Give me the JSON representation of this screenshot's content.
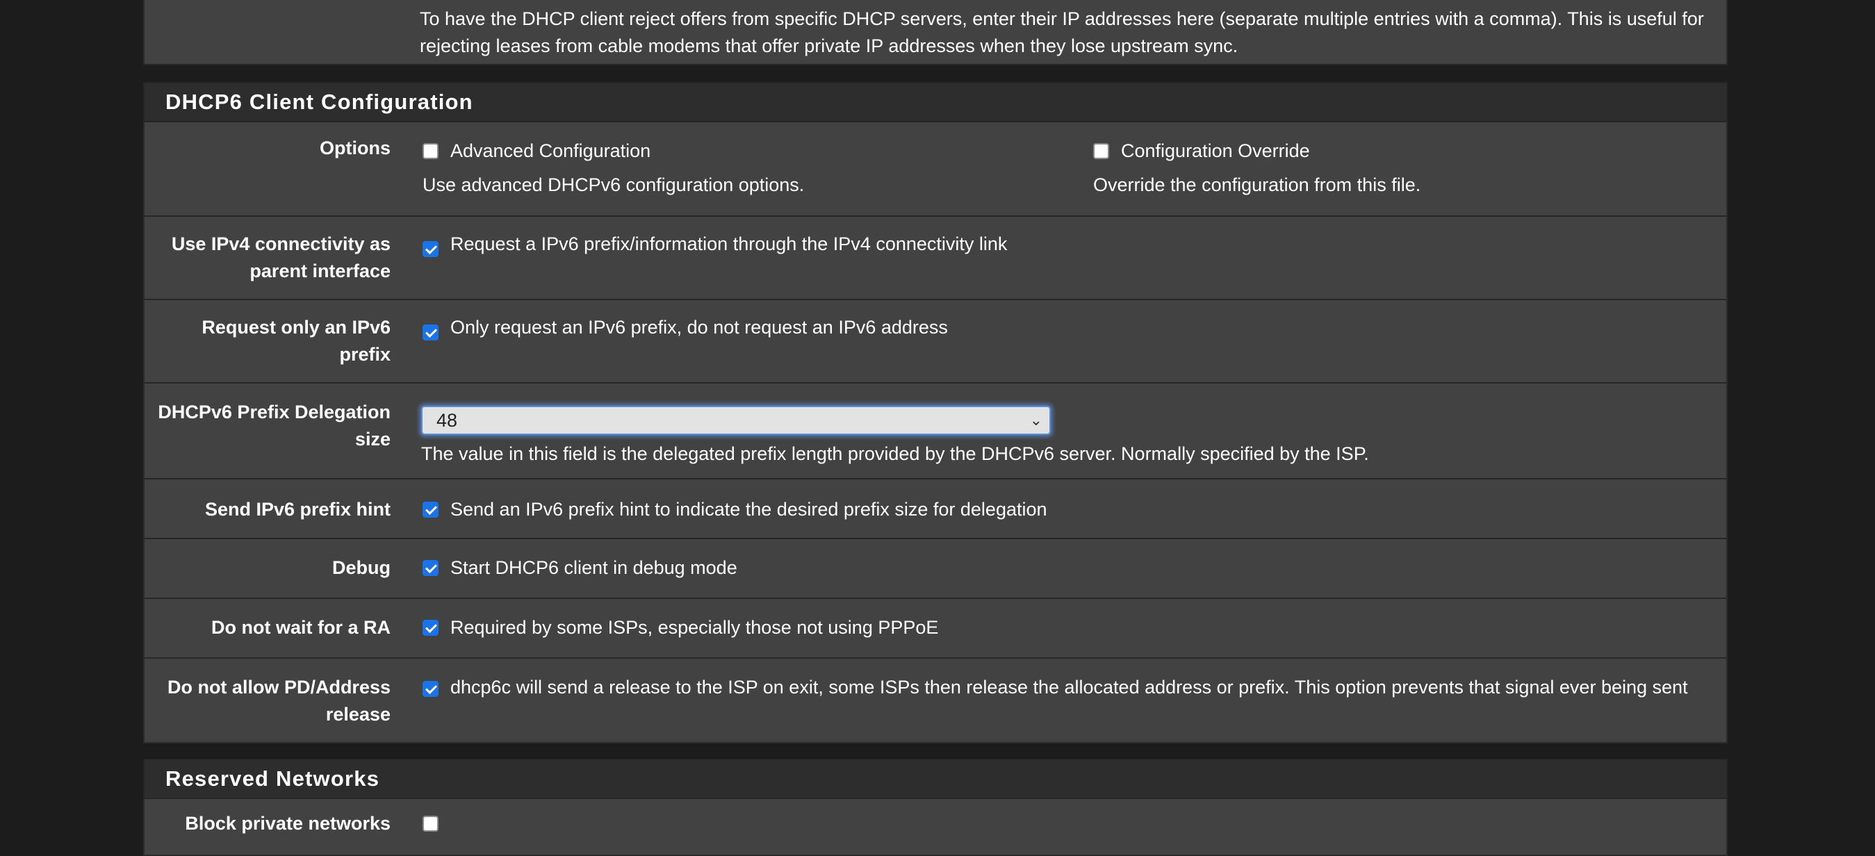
{
  "top_help": "To have the DHCP client reject offers from specific DHCP servers, enter their IP addresses here (separate multiple entries with a comma). This is useful for rejecting leases from cable modems that offer private IP addresses when they lose upstream sync.",
  "dhcp6": {
    "title": "DHCP6 Client Configuration",
    "options": {
      "label": "Options",
      "advanced": {
        "label": "Advanced Configuration",
        "help": "Use advanced DHCPv6 configuration options.",
        "checked": false
      },
      "override": {
        "label": "Configuration Override",
        "help": "Override the configuration from this file.",
        "checked": false
      }
    },
    "ipv4_parent": {
      "label": "Use IPv4 connectivity as parent interface",
      "text": "Request a IPv6 prefix/information through the IPv4 connectivity link",
      "checked": true
    },
    "prefix_only": {
      "label": "Request only an IPv6 prefix",
      "text": "Only request an IPv6 prefix, do not request an IPv6 address",
      "checked": true
    },
    "pd_size": {
      "label": "DHCPv6 Prefix Delegation size",
      "value": "48",
      "help": "The value in this field is the delegated prefix length provided by the DHCPv6 server. Normally specified by the ISP."
    },
    "prefix_hint": {
      "label": "Send IPv6 prefix hint",
      "text": "Send an IPv6 prefix hint to indicate the desired prefix size for delegation",
      "checked": true
    },
    "debug": {
      "label": "Debug",
      "text": "Start DHCP6 client in debug mode",
      "checked": true
    },
    "no_ra": {
      "label": "Do not wait for a RA",
      "text": "Required by some ISPs, especially those not using PPPoE",
      "checked": true
    },
    "no_release": {
      "label": "Do not allow PD/Address release",
      "text": "dhcp6c will send a release to the ISP on exit, some ISPs then release the allocated address or prefix. This option prevents that signal ever being sent",
      "checked": true
    }
  },
  "reserved": {
    "title": "Reserved Networks",
    "block_private": {
      "label": "Block private networks",
      "checked": false
    }
  }
}
